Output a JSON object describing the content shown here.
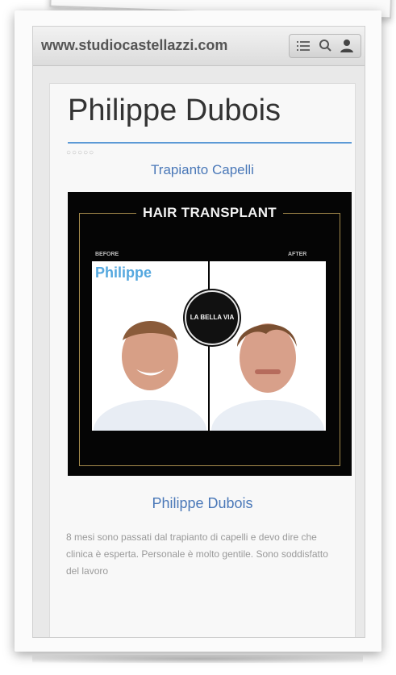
{
  "browser": {
    "url": "www.studiocastellazzi.com",
    "icons": [
      "list-icon",
      "search-icon",
      "user-icon"
    ]
  },
  "profile": {
    "title": "Philippe Dubois",
    "rating_dots": "○○○○○",
    "category": "Trapianto Capelli",
    "hero": {
      "title": "HAIR TRANSPLANT",
      "before_label": "BEFORE",
      "after_label": "AFTER",
      "photo_name": "Philippe",
      "badge_text": "LA BELLA VIA"
    },
    "name": "Philippe Dubois",
    "review": "8 mesi sono passati dal trapianto di capelli e devo dire che clinica è esperta. Personale è molto gentile. Sono soddisfatto del lavoro"
  }
}
